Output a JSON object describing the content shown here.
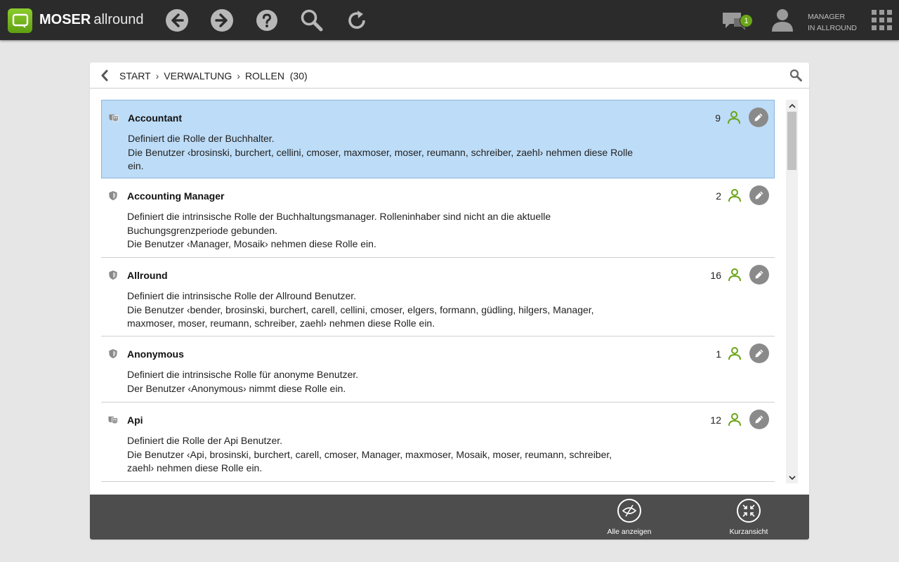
{
  "header": {
    "brand_bold": "MOSER",
    "brand_light": "allround",
    "chat_count": "1",
    "user_line1": "MANAGER",
    "user_line2": "IN ALLROUND"
  },
  "breadcrumb": {
    "items": [
      "START",
      "VERWALTUNG",
      "ROLLEN"
    ],
    "count": "(30)"
  },
  "roles": [
    {
      "title": "Accountant",
      "icon": "masks-icon",
      "count": "9",
      "selected": true,
      "desc": [
        "Definiert die Rolle der Buchhalter.",
        "Die Benutzer ‹brosinski, burchert, cellini, cmoser, maxmoser, moser, reumann, schreiber, zaehl› nehmen diese Rolle",
        "ein."
      ]
    },
    {
      "title": "Accounting Manager",
      "icon": "shield-icon",
      "count": "2",
      "selected": false,
      "desc": [
        "Definiert die intrinsische Rolle der Buchhaltungsmanager. Rolleninhaber sind nicht an die aktuelle",
        "Buchungsgrenzperiode gebunden.",
        "Die Benutzer ‹Manager, Mosaik› nehmen diese Rolle ein."
      ]
    },
    {
      "title": "Allround",
      "icon": "shield-icon",
      "count": "16",
      "selected": false,
      "desc": [
        "Definiert die intrinsische Rolle der Allround Benutzer.",
        "Die Benutzer ‹bender, brosinski, burchert, carell, cellini, cmoser, elgers, formann, güdling, hilgers, Manager,",
        "maxmoser, moser, reumann, schreiber, zaehl› nehmen diese Rolle ein."
      ]
    },
    {
      "title": "Anonymous",
      "icon": "shield-icon",
      "count": "1",
      "selected": false,
      "desc": [
        "Definiert die intrinsische Rolle für anonyme Benutzer.",
        "Der Benutzer ‹Anonymous› nimmt diese Rolle ein."
      ]
    },
    {
      "title": "Api",
      "icon": "masks-icon",
      "count": "12",
      "selected": false,
      "desc": [
        "Definiert die Rolle der Api Benutzer.",
        "Die Benutzer ‹Api, brosinski, burchert, carell, cmoser, Manager, maxmoser, Mosaik, moser, reumann, schreiber,",
        "zaehl› nehmen diese Rolle ein."
      ]
    }
  ],
  "footer": {
    "show_all": "Alle anzeigen",
    "short_view": "Kurzansicht"
  },
  "colors": {
    "accent_green": "#6aa516",
    "selected_bg": "#bddcf7",
    "topbar": "#2b2b2b",
    "footer": "#4d4d4d"
  }
}
